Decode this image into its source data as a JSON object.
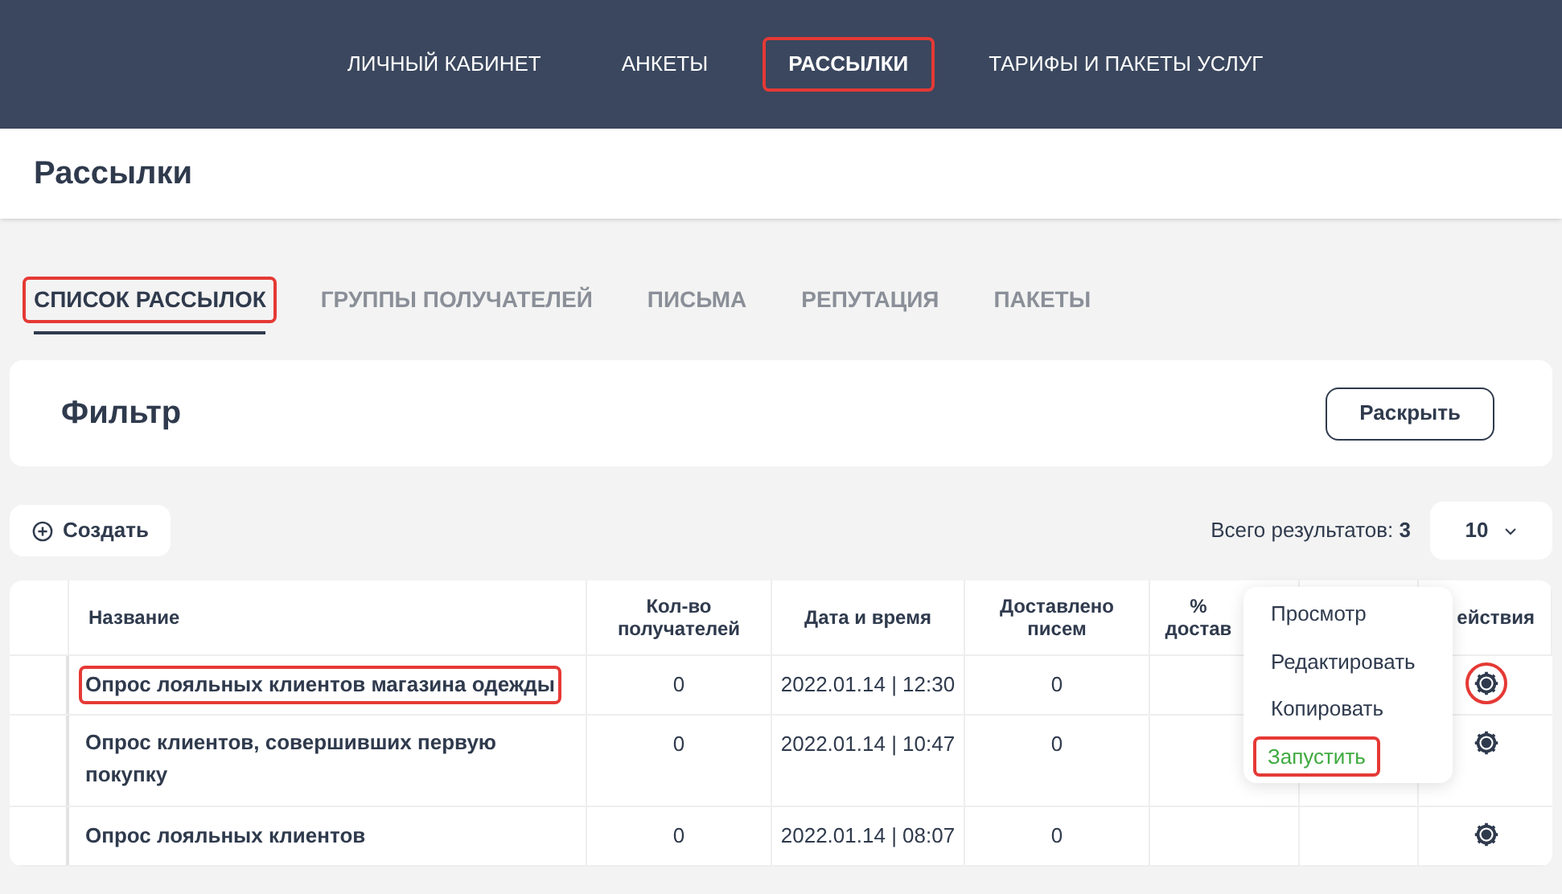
{
  "nav": [
    {
      "label": "ЛИЧНЫЙ КАБИНЕТ",
      "selected": false,
      "highlighted": false
    },
    {
      "label": "АНКЕТЫ",
      "selected": false,
      "highlighted": false
    },
    {
      "label": "РАССЫЛКИ",
      "selected": true,
      "highlighted": true
    },
    {
      "label": "ТАРИФЫ И ПАКЕТЫ УСЛУГ",
      "selected": false,
      "highlighted": false
    }
  ],
  "page_title": "Рассылки",
  "tabs": [
    {
      "label": "СПИСОК РАССЫЛОК",
      "selected": true,
      "highlighted": true
    },
    {
      "label": "ГРУППЫ ПОЛУЧАТЕЛЕЙ",
      "selected": false,
      "highlighted": false
    },
    {
      "label": "ПИСЬМА",
      "selected": false,
      "highlighted": false
    },
    {
      "label": "РЕПУТАЦИЯ",
      "selected": false,
      "highlighted": false
    },
    {
      "label": "ПАКЕТЫ",
      "selected": false,
      "highlighted": false
    }
  ],
  "filter": {
    "title": "Фильтр",
    "button": "Раскрыть"
  },
  "create_button": "Создать",
  "total": {
    "label": "Всего результатов:",
    "value": "3"
  },
  "page_size": "10",
  "table": {
    "columns": [
      "Название",
      "Кол-во получателей",
      "Дата и время",
      "Доставлено писем",
      "% достав",
      "ействия"
    ],
    "rows": [
      {
        "name": "Опрос лояльных клиентов магазина одежды",
        "recipients": "0",
        "datetime": "2022.01.14 | 12:30",
        "delivered": "0",
        "highlighted": true
      },
      {
        "name": "Опрос клиентов, совершивших первую покупку",
        "recipients": "0",
        "datetime": "2022.01.14 | 10:47",
        "delivered": "0",
        "highlighted": false
      },
      {
        "name": "Опрос лояльных клиентов",
        "recipients": "0",
        "datetime": "2022.01.14 | 08:07",
        "delivered": "0",
        "highlighted": false
      }
    ]
  },
  "menu": [
    {
      "label": "Просмотр",
      "kind": "normal",
      "highlighted": false
    },
    {
      "label": "Редактировать",
      "kind": "normal",
      "highlighted": false
    },
    {
      "label": "Копировать",
      "kind": "normal",
      "highlighted": false
    },
    {
      "label": "Запустить",
      "kind": "run",
      "highlighted": true
    }
  ]
}
